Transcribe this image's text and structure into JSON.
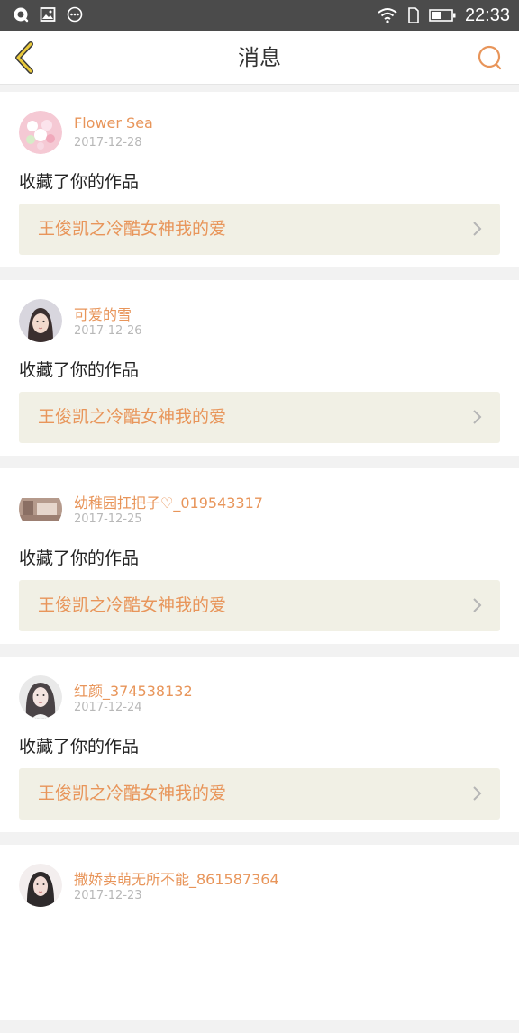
{
  "status_bar": {
    "time": "22:33",
    "left_icons": [
      "qq-icon",
      "image-icon",
      "more-dots-icon"
    ],
    "right_icons": [
      "wifi-icon",
      "sim-icon",
      "battery-icon"
    ]
  },
  "header": {
    "title": "消息",
    "accent_color": "#e8955a"
  },
  "messages": [
    {
      "username": "Flower Sea",
      "date": "2017-12-28",
      "action": "收藏了你的作品",
      "work_title": "王俊凯之冷酷女神我的爱",
      "avatar_color": "#e9b7c2"
    },
    {
      "username": "可爱的雪",
      "date": "2017-12-26",
      "action": "收藏了你的作品",
      "work_title": "王俊凯之冷酷女神我的爱",
      "avatar_color": "#c9c5d2"
    },
    {
      "username": "幼稚园扛把子♡_019543317",
      "date": "2017-12-25",
      "action": "收藏了你的作品",
      "work_title": "王俊凯之冷酷女神我的爱",
      "avatar_color": "#b89c8e"
    },
    {
      "username": "红颜_374538132",
      "date": "2017-12-24",
      "action": "收藏了你的作品",
      "work_title": "王俊凯之冷酷女神我的爱",
      "avatar_color": "#a7a4a6"
    },
    {
      "username": "撒娇卖萌无所不能_861587364",
      "date": "2017-12-23",
      "avatar_color": "#c4b3b1"
    }
  ]
}
